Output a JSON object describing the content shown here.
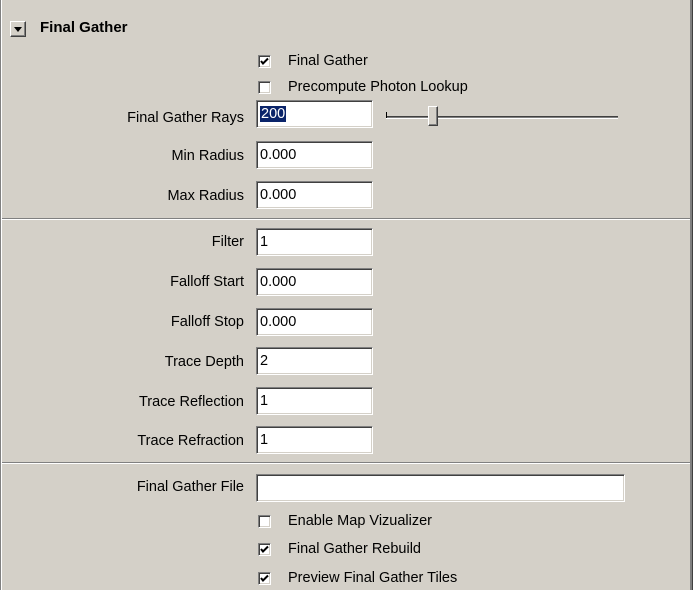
{
  "section": {
    "title": "Final Gather",
    "collapse_icon": "triangle-down"
  },
  "checkboxes": {
    "final_gather": {
      "label": "Final Gather",
      "checked": true
    },
    "precompute_photon_lookup": {
      "label": "Precompute Photon Lookup",
      "checked": false
    },
    "enable_map_vizualizer": {
      "label": "Enable Map Vizualizer",
      "checked": false
    },
    "final_gather_rebuild": {
      "label": "Final Gather Rebuild",
      "checked": true
    },
    "preview_final_gather_tiles": {
      "label": "Preview Final Gather Tiles",
      "checked": true
    }
  },
  "fields": {
    "final_gather_rays": {
      "label": "Final Gather Rays",
      "value": "200"
    },
    "min_radius": {
      "label": "Min Radius",
      "value": "0.000"
    },
    "max_radius": {
      "label": "Max Radius",
      "value": "0.000"
    },
    "filter": {
      "label": "Filter",
      "value": "1"
    },
    "falloff_start": {
      "label": "Falloff Start",
      "value": "0.000"
    },
    "falloff_stop": {
      "label": "Falloff Stop",
      "value": "0.000"
    },
    "trace_depth": {
      "label": "Trace Depth",
      "value": "2"
    },
    "trace_reflection": {
      "label": "Trace Reflection",
      "value": "1"
    },
    "trace_refraction": {
      "label": "Trace Refraction",
      "value": "1"
    },
    "final_gather_file": {
      "label": "Final Gather File",
      "value": ""
    }
  },
  "colors": {
    "panel_bg": "#d4d0c8",
    "selection_bg": "#0a246a"
  }
}
